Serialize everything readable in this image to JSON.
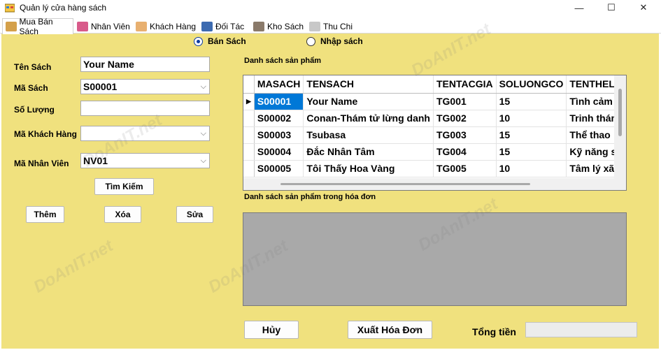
{
  "window": {
    "title": "Quản lý cửa hàng sách",
    "minimize_glyph": "—",
    "maximize_glyph": "☐",
    "close_glyph": "✕"
  },
  "tabs": [
    {
      "label": "Mua Bán Sách",
      "icon": "money-icon",
      "color": "#d4a04a"
    },
    {
      "label": "Nhân Viên",
      "icon": "person-icon",
      "color": "#d85a8a"
    },
    {
      "label": "Khách Hàng",
      "icon": "customer-icon",
      "color": "#e8b070"
    },
    {
      "label": "Đối Tác",
      "icon": "handshake-icon",
      "color": "#3c6ab0"
    },
    {
      "label": "Kho Sách",
      "icon": "warehouse-icon",
      "color": "#8a7a6a"
    },
    {
      "label": "Thu Chi",
      "icon": "chart-icon",
      "color": "#c8c8c8"
    }
  ],
  "mode": {
    "sell_label": "Bán Sách",
    "import_label": "Nhập sách",
    "selected": "sell"
  },
  "form": {
    "ten_sach_label": "Tên Sách",
    "ten_sach_value": "Your Name",
    "ma_sach_label": "Mã Sách",
    "ma_sach_value": "S00001",
    "so_luong_label": "Số Lượng",
    "so_luong_value": "",
    "ma_khach_hang_label": "Mã Khách Hàng",
    "ma_khach_hang_value": "",
    "ma_nhan_vien_label": "Mã Nhân Viên",
    "ma_nhan_vien_value": "NV01"
  },
  "buttons": {
    "tim_kiem": "Tìm Kiếm",
    "them": "Thêm",
    "xoa": "Xóa",
    "sua": "Sửa",
    "huy": "Hủy",
    "xuat_hoa_don": "Xuất Hóa Đơn"
  },
  "products": {
    "section_label": "Danh sách sản phẩm",
    "columns": [
      "MASACH",
      "TENSACH",
      "TENTACGIA",
      "SOLUONGCO",
      "TENTHELOAI"
    ],
    "rows": [
      [
        "S00001",
        "Your Name",
        "TG001",
        "15",
        "Tình cảm lãng mạn"
      ],
      [
        "S00002",
        "Conan-Thám tử lừng danh",
        "TG002",
        "10",
        "Trinh thám"
      ],
      [
        "S00003",
        "Tsubasa",
        "TG003",
        "15",
        "Thể thao"
      ],
      [
        "S00004",
        "Đắc Nhân Tâm",
        "TG004",
        "15",
        "Kỹ năng sống"
      ],
      [
        "S00005",
        "Tôi Thấy Hoa Vàng",
        "TG005",
        "10",
        "Tâm lý xã hội"
      ]
    ],
    "selected_row_marker": "▶"
  },
  "invoice": {
    "section_label": "Danh sách sản phẩm trong hóa đơn"
  },
  "total": {
    "label": "Tổng tiền",
    "value": ""
  },
  "colors": {
    "panel_bg": "#f0e17e",
    "selection": "#0078d7",
    "invoice_grid_bg": "#a9a9a9"
  },
  "watermark_text": "DoAnIT.net"
}
